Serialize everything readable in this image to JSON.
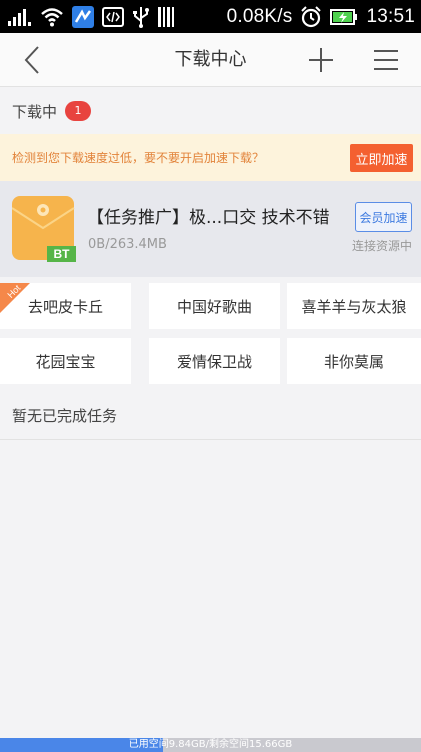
{
  "status_bar": {
    "speed": "0.08K/s",
    "time": "13:51",
    "icons": [
      "signal-icon",
      "wifi-icon",
      "app-notification-icon",
      "code-icon",
      "usb-icon",
      "barcode-icon",
      "alarm-icon",
      "battery-charging-icon"
    ]
  },
  "titlebar": {
    "title": "下载中心",
    "back_icon": "back-arrow-icon",
    "add_icon": "plus-icon",
    "menu_icon": "menu-icon"
  },
  "downloading": {
    "label": "下载中",
    "count": "1"
  },
  "speed_warning": {
    "message": "检测到您下载速度过低，要不要开启加速下载？",
    "button": "立即加速"
  },
  "task": {
    "name": "【任务推广】极...口交 技术不错",
    "size": "0B/263.4MB",
    "vip_button": "会员加速",
    "status": "连接资源中",
    "file_badge": "BT"
  },
  "hot": {
    "tag": "Hot",
    "items": [
      "去吧皮卡丘",
      "中国好歌曲",
      "喜羊羊与灰太狼",
      "花园宝宝",
      "爱情保卫战",
      "非你莫属"
    ]
  },
  "completed": {
    "label": "暂无已完成任务"
  },
  "storage": {
    "text": "已用空间9.84GB/剩余空间15.66GB",
    "used_fraction": 0.386
  },
  "colors": {
    "accent_orange": "#f46030",
    "badge_red": "#e8433f",
    "vip_blue": "#3d7ae0",
    "warning_bg": "#fdf3dc",
    "storage_blue": "#4a86e8"
  }
}
